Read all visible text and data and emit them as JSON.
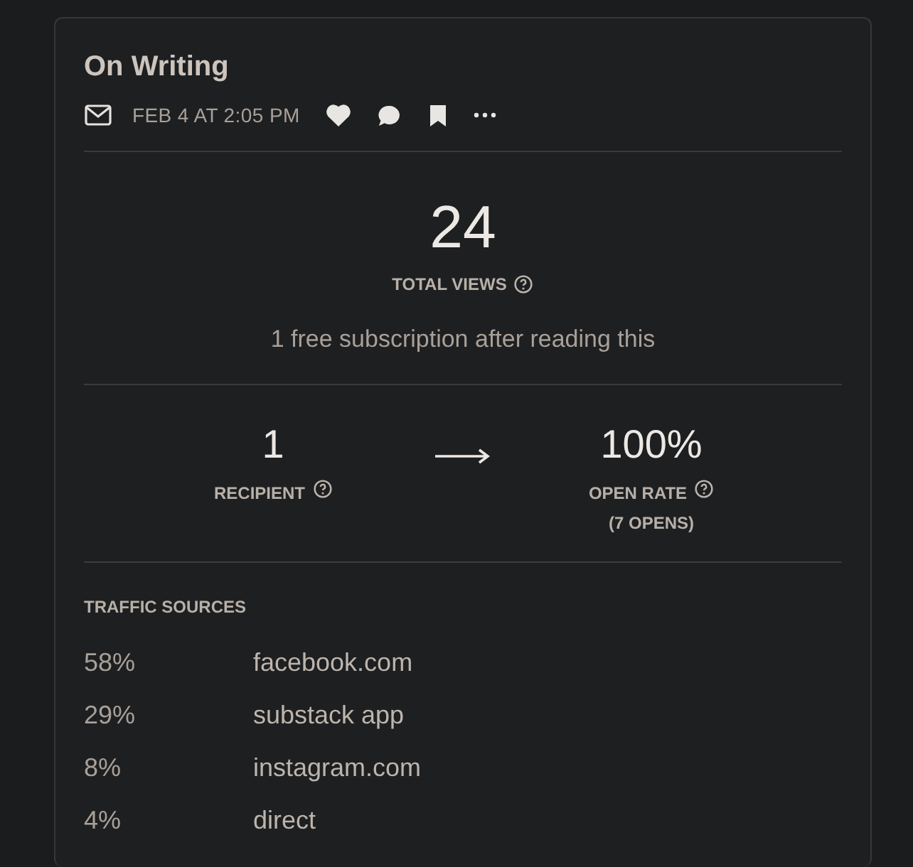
{
  "post": {
    "title": "On Writing",
    "date": "FEB 4 AT 2:05 PM",
    "liked": true
  },
  "views": {
    "value": "24",
    "label": "TOTAL VIEWS",
    "note": "1 free subscription after reading this"
  },
  "funnel": [
    {
      "value": "1",
      "label": "RECIPIENT"
    },
    {
      "value": "100%",
      "label": "OPEN RATE",
      "sub": "(7 OPENS)"
    }
  ],
  "traffic_sources": {
    "title": "TRAFFIC SOURCES",
    "rows": [
      {
        "share": "58%",
        "source": "facebook.com"
      },
      {
        "share": "29%",
        "source": "substack app"
      },
      {
        "share": "8%",
        "source": "instagram.com"
      },
      {
        "share": "4%",
        "source": "direct"
      }
    ]
  }
}
